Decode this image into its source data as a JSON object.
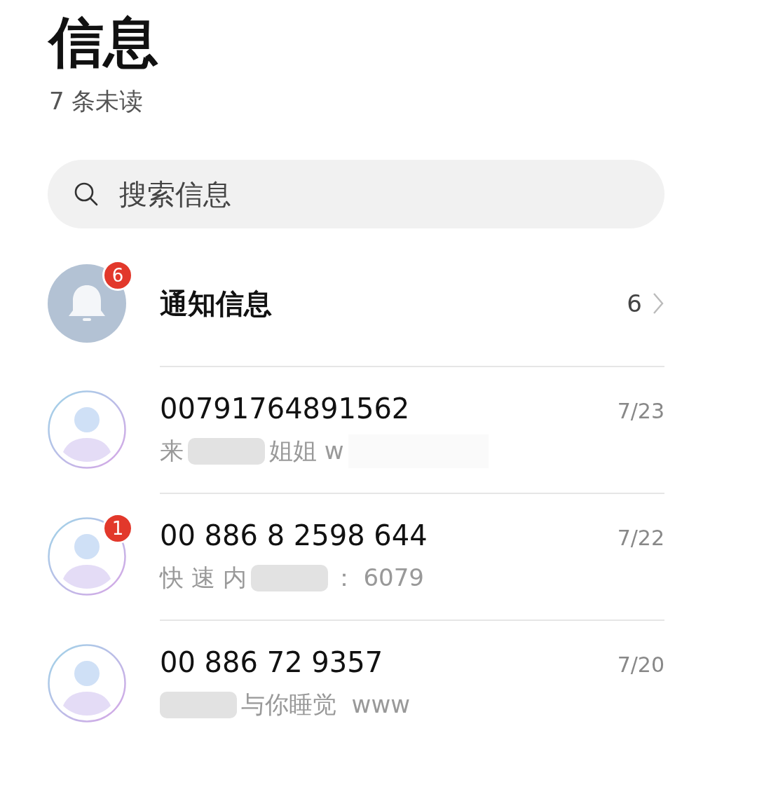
{
  "header": {
    "title": "信息",
    "subtitle": "7 条未读"
  },
  "search": {
    "placeholder": "搜索信息"
  },
  "notification": {
    "title": "通知信息",
    "badge": "6",
    "count": "6"
  },
  "conversations": [
    {
      "name": "00791764891562",
      "date": "7/23",
      "preview": [
        {
          "kind": "text",
          "text": "来"
        },
        {
          "kind": "redacted"
        },
        {
          "kind": "text",
          "text": "姐姐 w"
        },
        {
          "kind": "cover"
        }
      ]
    },
    {
      "name": "00 886 8 2598 644",
      "date": "7/22",
      "badge": "1",
      "preview": [
        {
          "kind": "text",
          "text": "快 速 内"
        },
        {
          "kind": "redacted"
        },
        {
          "kind": "text",
          "text": "： 6079"
        }
      ]
    },
    {
      "name": "00 886 72 9357",
      "date": "7/20",
      "preview": [
        {
          "kind": "redacted"
        },
        {
          "kind": "text",
          "text": "与你睡觉  www"
        }
      ]
    }
  ]
}
